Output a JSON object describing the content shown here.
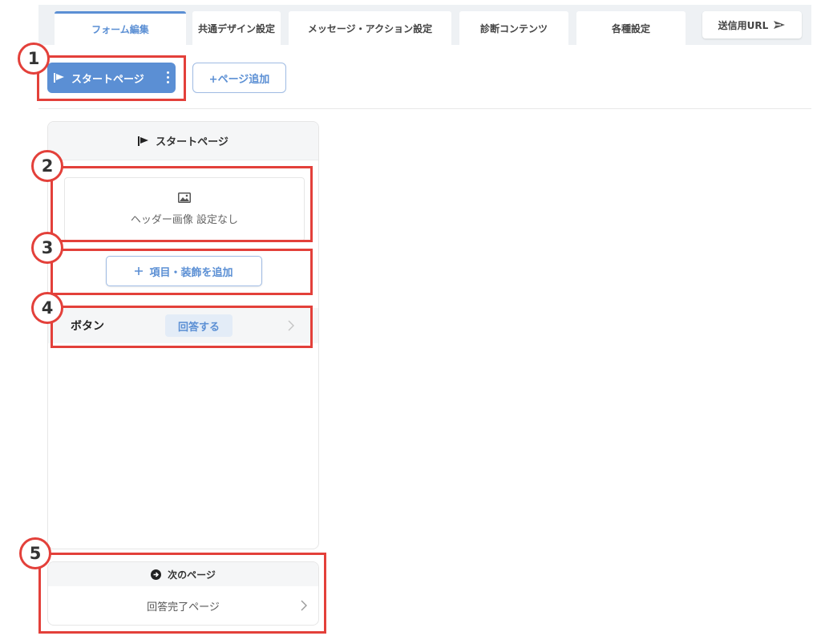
{
  "tabs": [
    {
      "label": "フォーム編集",
      "active": true
    },
    {
      "label": "共通デザイン設定",
      "active": false
    },
    {
      "label": "メッセージ・アクション設定",
      "active": false
    },
    {
      "label": "診断コンテンツ",
      "active": false
    },
    {
      "label": "各種設定",
      "active": false
    }
  ],
  "send_url_label": "送信用URL",
  "start_page_button": "スタートページ",
  "add_page_button": "+ページ追加",
  "panel": {
    "title": "スタートページ",
    "header_image_label": "ヘッダー画像 設定なし",
    "add_item_label": "項目・装飾を追加",
    "button_row_label": "ボタン",
    "button_row_value": "回答する"
  },
  "next_page": {
    "title": "次のページ",
    "target": "回答完了ページ"
  },
  "annotations": [
    "1",
    "2",
    "3",
    "4",
    "5"
  ],
  "colors": {
    "accent": "#5b8fd4",
    "annotation": "#e3403a"
  }
}
